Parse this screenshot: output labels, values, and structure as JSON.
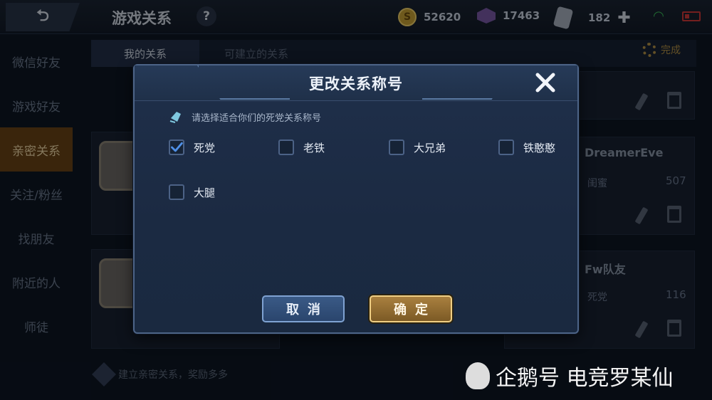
{
  "topbar": {
    "back_label": "⮌",
    "title": "游戏关系",
    "help_label": "?",
    "gold": "52620",
    "gems": "17463",
    "tickets": "182"
  },
  "sidebar": {
    "items": [
      {
        "label": "微信好友",
        "active": false
      },
      {
        "label": "游戏好友",
        "active": false
      },
      {
        "label": "亲密关系",
        "active": true
      },
      {
        "label": "关注/粉丝",
        "active": false
      },
      {
        "label": "找朋友",
        "active": false
      },
      {
        "label": "附近的人",
        "active": false
      },
      {
        "label": "师徒",
        "active": false
      }
    ]
  },
  "tabs": [
    {
      "label": "我的关系",
      "active": true
    },
    {
      "label": "可建立的关系",
      "active": false
    }
  ],
  "done_label": "完成",
  "cards": [
    {
      "name": "DreamerEve",
      "relation": "闺蜜",
      "value": "507"
    },
    {
      "name": "Fw队友",
      "relation": "死党",
      "value": "116"
    }
  ],
  "footer_note": "建立亲密关系，奖励多多",
  "watermark": "企鹅号 电竞罗某仙",
  "dialog": {
    "title": "更改关系称号",
    "prompt": "请选择适合你们的死党关系称号",
    "options": [
      {
        "label": "死党",
        "checked": true
      },
      {
        "label": "老铁",
        "checked": false
      },
      {
        "label": "大兄弟",
        "checked": false
      },
      {
        "label": "铁憨憨",
        "checked": false
      },
      {
        "label": "大腿",
        "checked": false
      }
    ],
    "cancel_label": "取消",
    "confirm_label": "确定"
  },
  "colors": {
    "accent_gold": "#b49245",
    "confirm_bg": "#a9803f",
    "cancel_bg": "#3a5a86",
    "check_color": "#4f8fe6"
  },
  "icons": [
    "back-icon",
    "help-icon",
    "coin-icon",
    "gem-icon",
    "ticket-icon",
    "plus-icon",
    "wifi-icon",
    "battery-icon",
    "gear-icon",
    "edit-icon",
    "trash-icon",
    "close-icon",
    "tag-icon",
    "checkmark-icon",
    "penguin-icon"
  ]
}
